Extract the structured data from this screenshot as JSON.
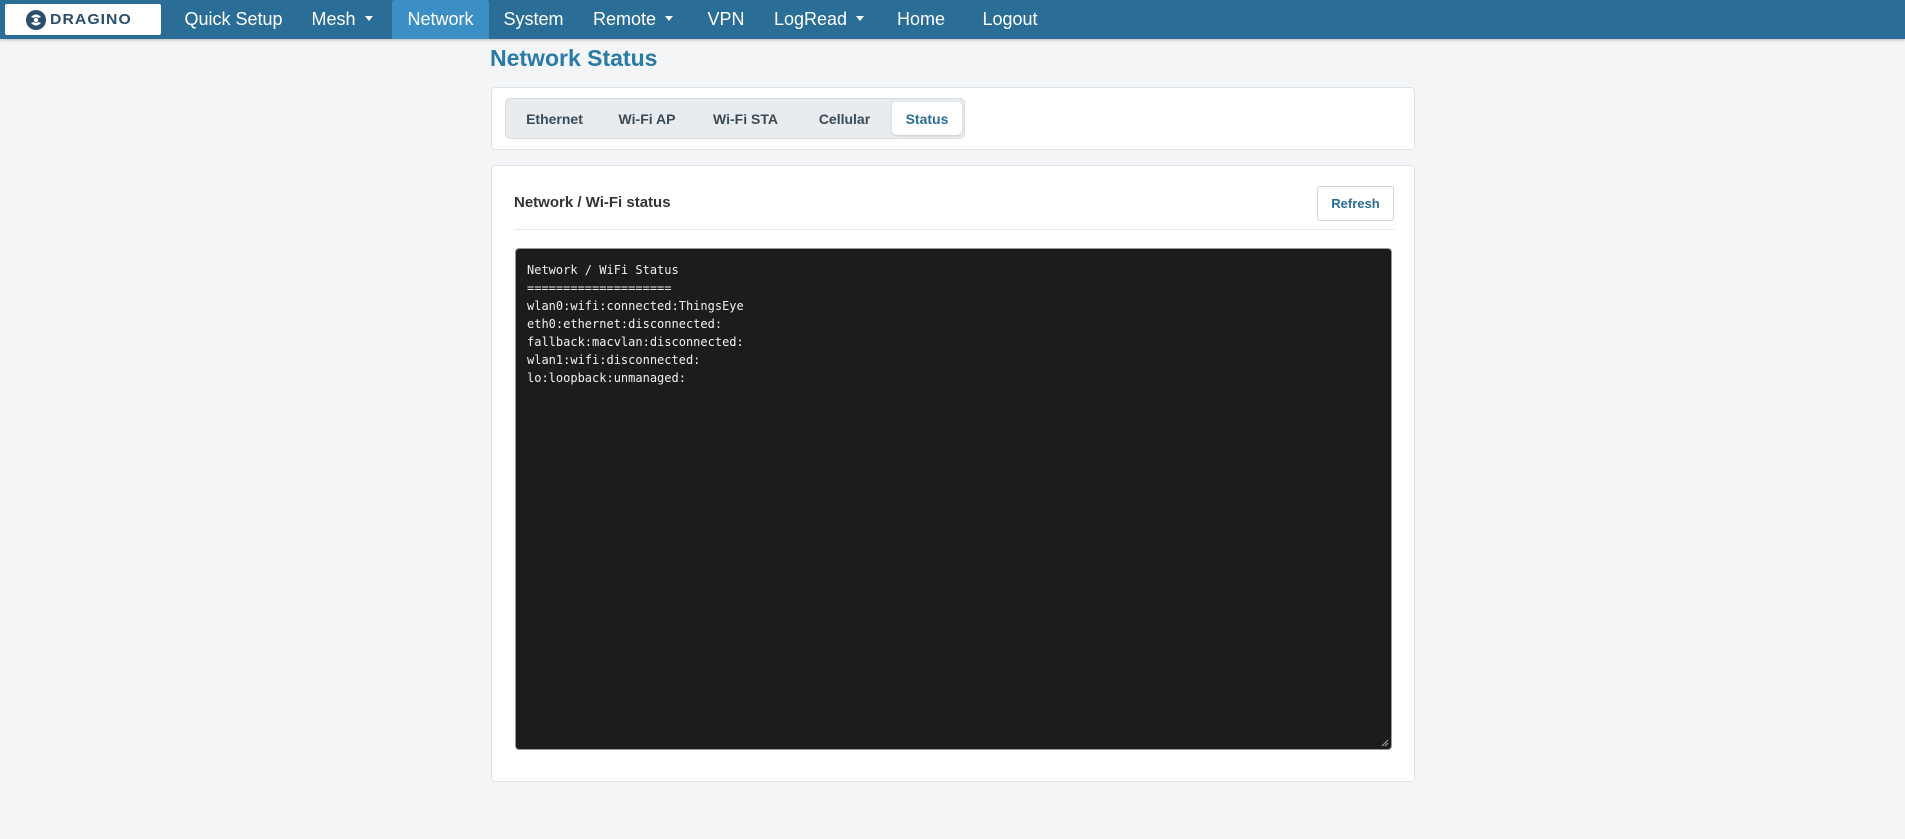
{
  "brand": {
    "logo_text": "DRAGINO"
  },
  "nav": {
    "items": [
      {
        "label": "Quick Setup"
      },
      {
        "label": "Mesh"
      },
      {
        "label": "Network"
      },
      {
        "label": "System"
      },
      {
        "label": "Remote"
      },
      {
        "label": "VPN"
      },
      {
        "label": "LogRead"
      },
      {
        "label": "Home"
      },
      {
        "label": "Logout"
      }
    ],
    "active": "Network",
    "colors": {
      "bar": "#2a6d96",
      "active": "#3b8fc4"
    }
  },
  "page": {
    "title": "Network Status"
  },
  "tabs": {
    "items": [
      {
        "label": "Ethernet"
      },
      {
        "label": "Wi-Fi AP"
      },
      {
        "label": "Wi-Fi STA"
      },
      {
        "label": "Cellular"
      },
      {
        "label": "Status"
      }
    ],
    "active": "Status"
  },
  "status_section": {
    "title": "Network / Wi-Fi status",
    "refresh_label": "Refresh",
    "console_lines": [
      "Network / WiFi Status",
      "====================",
      "wlan0:wifi:connected:ThingsEye",
      "eth0:ethernet:disconnected:",
      "fallback:macvlan:disconnected:",
      "wlan1:wifi:disconnected:",
      "lo:loopback:unmanaged:"
    ]
  }
}
